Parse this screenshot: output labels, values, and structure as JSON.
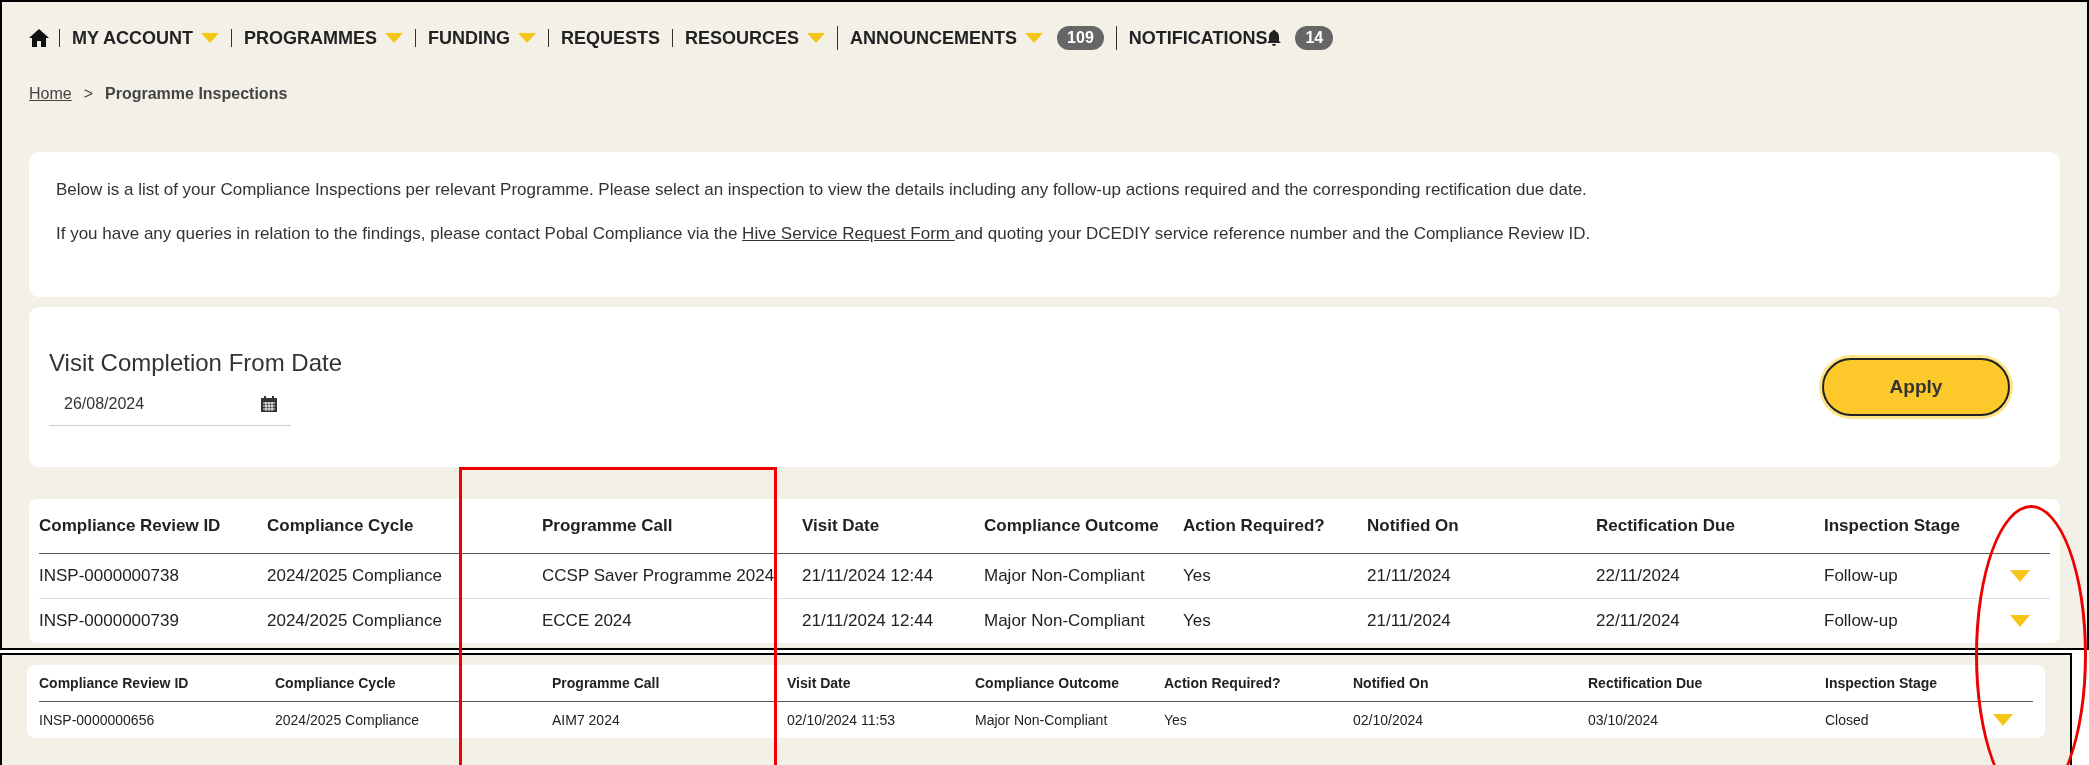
{
  "nav": {
    "items": [
      {
        "label": "MY ACCOUNT",
        "dropdown": true
      },
      {
        "label": "PROGRAMMES",
        "dropdown": true
      },
      {
        "label": "FUNDING",
        "dropdown": true
      },
      {
        "label": "REQUESTS",
        "dropdown": false
      },
      {
        "label": "RESOURCES",
        "dropdown": true
      },
      {
        "label": "ANNOUNCEMENTS",
        "dropdown": true,
        "badge": "109"
      },
      {
        "label": "NOTIFICATIONS",
        "dropdown": false,
        "bell": true,
        "badge": "14"
      }
    ]
  },
  "breadcrumb": {
    "home": "Home",
    "separator": ">",
    "current": "Programme Inspections"
  },
  "info": {
    "paragraph_1": "Below is a list of your Compliance Inspections per relevant Programme. Please select an inspection to view the details including any follow-up actions required and the corresponding rectification due date.",
    "paragraph_2_before": "If you have any queries in relation to the findings, please contact Pobal Compliance via the",
    "paragraph_2_link": "Hive Service Request Form ",
    "paragraph_2_after": "and quoting your DCEDIY service reference number and the Compliance Review ID."
  },
  "filter": {
    "label": "Visit Completion From Date",
    "value": "26/08/2024",
    "apply": "Apply"
  },
  "table": {
    "columns": [
      "Compliance Review ID",
      "Compliance Cycle",
      "Programme Call",
      "Visit Date",
      "Compliance Outcome",
      "Action Required?",
      "Notified On",
      "Rectification Due",
      "Inspection Stage"
    ],
    "rows": [
      [
        "INSP-0000000738",
        "2024/2025 Compliance",
        "CCSP Saver Programme 2024",
        "21/11/2024 12:44",
        "Major Non-Compliant",
        "Yes",
        "21/11/2024",
        "22/11/2024",
        "Follow-up"
      ],
      [
        "INSP-0000000739",
        "2024/2025 Compliance",
        "ECCE 2024",
        "21/11/2024 12:44",
        "Major Non-Compliant",
        "Yes",
        "21/11/2024",
        "22/11/2024",
        "Follow-up"
      ]
    ]
  },
  "second_table": {
    "columns": [
      "Compliance Review ID",
      "Compliance Cycle",
      "Programme Call",
      "Visit Date",
      "Compliance Outcome",
      "Action Required?",
      "Notified On",
      "Rectification Due",
      "Inspection Stage"
    ],
    "rows": [
      [
        "INSP-0000000656",
        "2024/2025 Compliance",
        "AIM7 2024",
        "02/10/2024 11:53",
        "Major Non-Compliant",
        "Yes",
        "02/10/2024",
        "03/10/2024",
        "Closed"
      ]
    ]
  }
}
